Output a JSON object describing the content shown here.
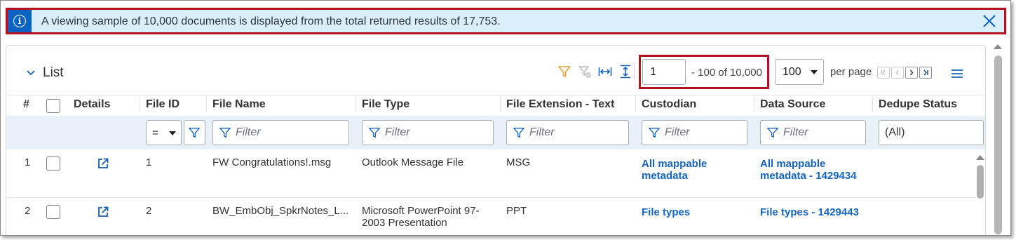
{
  "banner": {
    "message": "A viewing sample of 10,000 documents is displayed from the total returned results of 17,753."
  },
  "list": {
    "title": "List"
  },
  "pager": {
    "page": "1",
    "range": "- 100 of 10,000",
    "per_page_value": "100",
    "per_page_label": "per page"
  },
  "columns": {
    "num": "#",
    "details": "Details",
    "file_id": "File ID",
    "file_name": "File Name",
    "file_type": "File Type",
    "file_ext": "File Extension - Text",
    "custodian": "Custodian",
    "data_source": "Data Source",
    "dedupe": "Dedupe Status"
  },
  "filters": {
    "operator": "=",
    "placeholder": "Filter",
    "dedupe_value": "(All)"
  },
  "rows": [
    {
      "num": "1",
      "file_id": "1",
      "file_name": "FW Congratulations!.msg",
      "file_type": "Outlook Message File",
      "file_ext": "MSG",
      "custodian": "All mappable metadata",
      "data_source": "All mappable metadata - 1429434"
    },
    {
      "num": "2",
      "file_id": "2",
      "file_name": "BW_EmbObj_SpkrNotes_L...",
      "file_type": "Microsoft PowerPoint 97-2003 Presentation",
      "file_ext": "PPT",
      "custodian": "File types",
      "data_source": "File types - 1429443"
    }
  ],
  "colors": {
    "accent": "#0d63c3",
    "highlight": "#b3121f",
    "banner_bg": "#dbeffa",
    "link": "#1564c0",
    "filter_active": "#e8a13a"
  },
  "icons": [
    "info-icon",
    "close-icon",
    "chevron-down-icon",
    "filter-icon",
    "clear-filter-icon",
    "fit-width-icon",
    "fit-height-icon",
    "first-page-icon",
    "prev-page-icon",
    "next-page-icon",
    "last-page-icon",
    "menu-icon",
    "open-details-icon"
  ]
}
